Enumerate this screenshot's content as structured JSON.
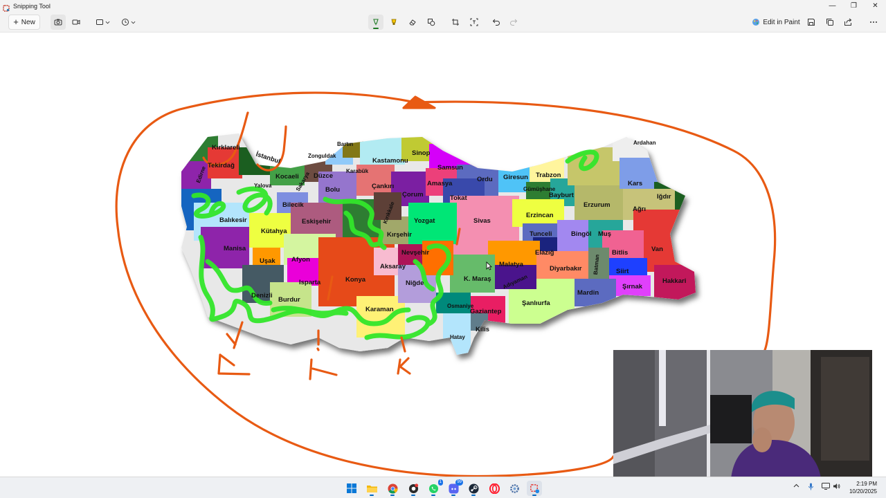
{
  "window": {
    "title": "Snipping Tool",
    "controls": {
      "minimize": "—",
      "restore": "❐",
      "close": "✕"
    }
  },
  "toolbar": {
    "new_label": "New",
    "edit_in_paint_label": "Edit in Paint",
    "active_tool": "ballpoint-pen",
    "pen_color": "#1e7a24",
    "highlighter_color": "#f5c400"
  },
  "map": {
    "provinces": [
      {
        "name": "Kırklareli"
      },
      {
        "name": "Tekirdağ"
      },
      {
        "name": "Edirne"
      },
      {
        "name": "İstanbul"
      },
      {
        "name": "Kocaeli"
      },
      {
        "name": "Sakarya"
      },
      {
        "name": "Yalova"
      },
      {
        "name": "Düzce"
      },
      {
        "name": "Zonguldak"
      },
      {
        "name": "Bartın"
      },
      {
        "name": "Karabük"
      },
      {
        "name": "Kastamonu"
      },
      {
        "name": "Sinop"
      },
      {
        "name": "Samsun"
      },
      {
        "name": "Bolu"
      },
      {
        "name": "Çankırı"
      },
      {
        "name": "Çorum"
      },
      {
        "name": "Amasya"
      },
      {
        "name": "Ordu"
      },
      {
        "name": "Giresun"
      },
      {
        "name": "Trabzon"
      },
      {
        "name": "Ardahan"
      },
      {
        "name": "Kars"
      },
      {
        "name": "Iğdır"
      },
      {
        "name": "Ağrı"
      },
      {
        "name": "Erzurum"
      },
      {
        "name": "Gümüşhane"
      },
      {
        "name": "Bayburt"
      },
      {
        "name": "Tokat"
      },
      {
        "name": "Sivas"
      },
      {
        "name": "Erzincan"
      },
      {
        "name": "Tunceli"
      },
      {
        "name": "Bingöl"
      },
      {
        "name": "Muş"
      },
      {
        "name": "Van"
      },
      {
        "name": "Bitlis"
      },
      {
        "name": "Elazığ"
      },
      {
        "name": "Malatya"
      },
      {
        "name": "Diyarbakır"
      },
      {
        "name": "Batman"
      },
      {
        "name": "Siirt"
      },
      {
        "name": "Şırnak"
      },
      {
        "name": "Hakkari"
      },
      {
        "name": "Mardin"
      },
      {
        "name": "Şanlıurfa"
      },
      {
        "name": "Adıyaman"
      },
      {
        "name": "K. Maraş"
      },
      {
        "name": "Gaziantep"
      },
      {
        "name": "Osmaniye"
      },
      {
        "name": "Kilis"
      },
      {
        "name": "Hatay"
      },
      {
        "name": "Balıkesir"
      },
      {
        "name": "Bilecik"
      },
      {
        "name": "Kütahya"
      },
      {
        "name": "Eskişehir"
      },
      {
        "name": "Manisa"
      },
      {
        "name": "Uşak"
      },
      {
        "name": "Afyon"
      },
      {
        "name": "Isparta"
      },
      {
        "name": "Denizli"
      },
      {
        "name": "Burdur"
      },
      {
        "name": "Konya"
      },
      {
        "name": "Karaman"
      },
      {
        "name": "Aksaray"
      },
      {
        "name": "Niğde"
      },
      {
        "name": "Nevşehir"
      },
      {
        "name": "Kırşehir"
      },
      {
        "name": "Kırıkkale"
      },
      {
        "name": "Yozgat"
      }
    ]
  },
  "taskbar": {
    "apps": [
      {
        "icon": "windows-start-icon"
      },
      {
        "icon": "file-explorer-icon"
      },
      {
        "icon": "chrome-icon"
      },
      {
        "icon": "app-record-icon"
      },
      {
        "icon": "whatsapp-icon",
        "badge": "1"
      },
      {
        "icon": "discord-icon",
        "badge": "99"
      },
      {
        "icon": "steam-icon"
      },
      {
        "icon": "opera-icon"
      },
      {
        "icon": "settings-gear-icon"
      },
      {
        "icon": "snipping-tool-icon"
      }
    ],
    "clock": {
      "time": "2:19 PM",
      "date": "10/20/2025"
    }
  }
}
